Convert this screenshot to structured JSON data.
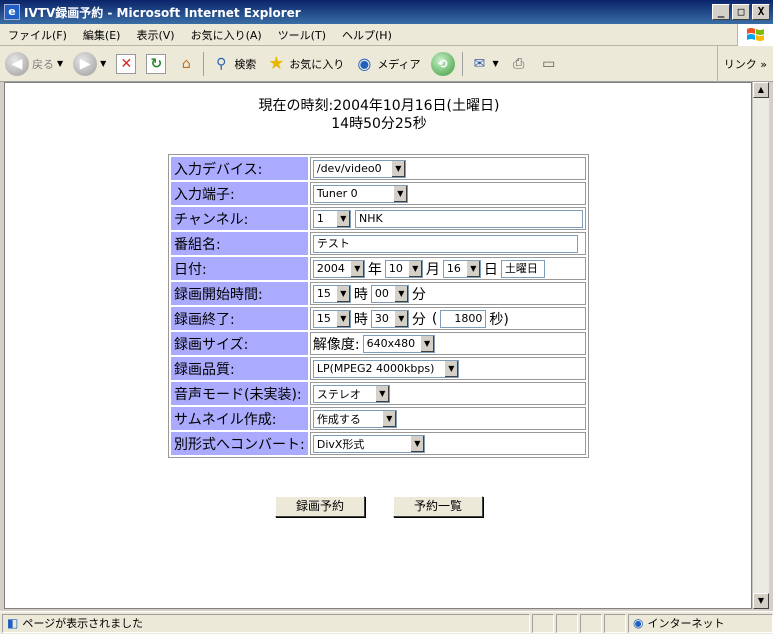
{
  "window": {
    "title": "IVTV録画予約 - Microsoft Internet Explorer",
    "app_icon": "e",
    "buttons": {
      "minimize": "_",
      "maximize": "□",
      "close": "X"
    }
  },
  "menu": {
    "items": [
      "ファイル(F)",
      "編集(E)",
      "表示(V)",
      "お気に入り(A)",
      "ツール(T)",
      "ヘルプ(H)"
    ]
  },
  "toolbar": {
    "back": "戻る",
    "search": "検索",
    "favorites": "お気に入り",
    "media": "メディア",
    "links": "リンク »"
  },
  "page": {
    "clock_line1": "現在の時刻:2004年10月16日(土曜日)",
    "clock_line2": "14時50分25秒",
    "rows": {
      "device": {
        "label": "入力デバイス:",
        "value": "/dev/video0"
      },
      "input": {
        "label": "入力端子:",
        "value": "Tuner 0"
      },
      "channel": {
        "label": "チャンネル:",
        "number": "1",
        "name": "NHK"
      },
      "program": {
        "label": "番組名:",
        "value": "テスト"
      },
      "date": {
        "label": "日付:",
        "year": "2004",
        "year_unit": "年",
        "month": "10",
        "month_unit": "月",
        "day": "16",
        "day_unit": "日",
        "weekday": "土曜日"
      },
      "start": {
        "label": "録画開始時間:",
        "hour": "15",
        "hour_unit": "時",
        "minute": "00",
        "minute_unit": "分"
      },
      "end": {
        "label": "録画終了:",
        "hour": "15",
        "hour_unit": "時",
        "minute": "30",
        "minute_unit": "分",
        "paren_open": "(",
        "seconds": "1800",
        "seconds_unit": "秒)"
      },
      "size": {
        "label": "録画サイズ:",
        "prefix": "解像度:",
        "value": "640x480"
      },
      "quality": {
        "label": "録画品質:",
        "value": "LP(MPEG2 4000kbps)"
      },
      "audio": {
        "label": "音声モード(未実装):",
        "value": "ステレオ"
      },
      "thumbnail": {
        "label": "サムネイル作成:",
        "value": "作成する"
      },
      "convert": {
        "label": "別形式へコンバート:",
        "value": "DivX形式"
      }
    },
    "buttons": {
      "reserve": "録画予約",
      "list": "予約一覧"
    }
  },
  "status": {
    "text": "ページが表示されました",
    "zone": "インターネット"
  },
  "colors": {
    "label_bg": "#aaaaff",
    "titlebar": "#0a246a"
  }
}
